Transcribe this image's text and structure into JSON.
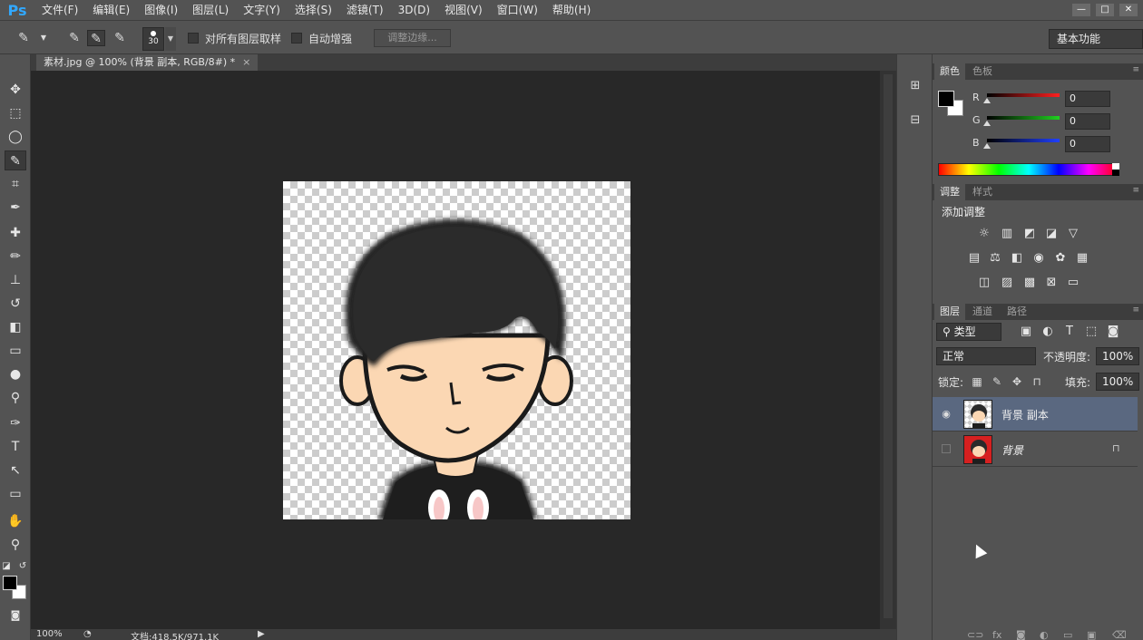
{
  "app": {
    "logo": "Ps"
  },
  "menu": [
    "文件(F)",
    "编辑(E)",
    "图像(I)",
    "图层(L)",
    "文字(Y)",
    "选择(S)",
    "滤镜(T)",
    "3D(D)",
    "视图(V)",
    "窗口(W)",
    "帮助(H)"
  ],
  "window_controls": [
    "—",
    "□",
    "✕"
  ],
  "options": {
    "brush_size": "30",
    "sample_all_layers": "对所有图层取样",
    "auto_enhance": "自动增强",
    "refine_edge": "调整边缘...",
    "workspace": "基本功能"
  },
  "document": {
    "tab_title": "素材.jpg @ 100% (背景 副本, RGB/8#) *",
    "close": "×",
    "zoom": "100%",
    "doc_info": "文档:418.5K/971.1K"
  },
  "color_panel": {
    "tabs": [
      "颜色",
      "色板"
    ],
    "channels": [
      {
        "label": "R",
        "value": "0",
        "color": "#ff2020"
      },
      {
        "label": "G",
        "value": "0",
        "color": "#20d020"
      },
      {
        "label": "B",
        "value": "0",
        "color": "#2040ff"
      }
    ]
  },
  "adjustments_panel": {
    "tabs": [
      "调整",
      "样式"
    ],
    "title": "添加调整"
  },
  "layers_panel": {
    "tabs": [
      "图层",
      "通道",
      "路径"
    ],
    "filter_kind": "类型",
    "blend_mode": "正常",
    "opacity_label": "不透明度:",
    "opacity": "100%",
    "lock_label": "锁定:",
    "fill_label": "填充:",
    "fill": "100%",
    "layers": [
      {
        "name": "背景 副本",
        "visible": true,
        "selected": true
      },
      {
        "name": "背景",
        "visible": false,
        "selected": false,
        "locked": true
      }
    ]
  },
  "colors": {
    "accent": "#31a8ff",
    "panel": "#535353",
    "selected_layer": "#5a6880"
  }
}
